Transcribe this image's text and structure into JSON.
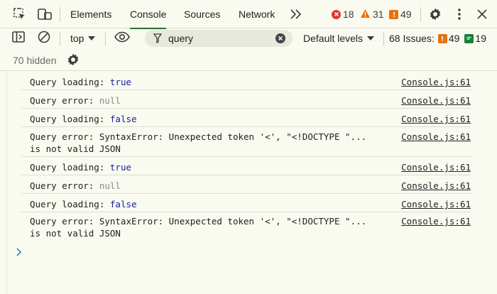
{
  "tabbar": {
    "tabs": [
      {
        "label": "Elements"
      },
      {
        "label": "Console"
      },
      {
        "label": "Sources"
      },
      {
        "label": "Network"
      }
    ],
    "errors": "18",
    "warnings": "31",
    "infos": "49"
  },
  "toolbar": {
    "context": "top",
    "filter_value": "query",
    "levels": "Default levels",
    "issues_label": "68 Issues:",
    "issues_info": "49",
    "issues_msg": "19"
  },
  "row2": {
    "hidden": "70 hidden"
  },
  "messages": [
    {
      "prefix": "Query loading: ",
      "value": "true",
      "kind": "true",
      "source": "Console.js:61"
    },
    {
      "prefix": "Query error: ",
      "value": "null",
      "kind": "null",
      "source": "Console.js:61"
    },
    {
      "prefix": "Query loading: ",
      "value": "false",
      "kind": "false",
      "source": "Console.js:61"
    },
    {
      "prefix": "Query error: SyntaxError: Unexpected token '<', \"<!DOCTYPE \"...\nis not valid JSON",
      "value": "",
      "kind": "plain",
      "source": "Console.js:61"
    },
    {
      "prefix": "Query loading: ",
      "value": "true",
      "kind": "true",
      "source": "Console.js:61"
    },
    {
      "prefix": "Query error: ",
      "value": "null",
      "kind": "null",
      "source": "Console.js:61"
    },
    {
      "prefix": "Query loading: ",
      "value": "false",
      "kind": "false",
      "source": "Console.js:61"
    },
    {
      "prefix": "Query error: SyntaxError: Unexpected token '<', \"<!DOCTYPE \"...\nis not valid JSON",
      "value": "",
      "kind": "plain",
      "source": "Console.js:61"
    }
  ],
  "colors": {
    "accent": "#2f6e2f",
    "error": "#dc362e",
    "warning": "#e8710a",
    "info_green": "#188038",
    "value_blue": "#1a1aa6"
  },
  "icons": [
    "inspect-icon",
    "device-toggle-icon",
    "more-tabs-icon",
    "gear-icon",
    "kebab-icon",
    "close-icon",
    "sidebar-icon",
    "clear-icon",
    "eye-icon",
    "filter-icon",
    "clear-filter-icon",
    "settings-icon",
    "prompt-chevron-icon"
  ]
}
